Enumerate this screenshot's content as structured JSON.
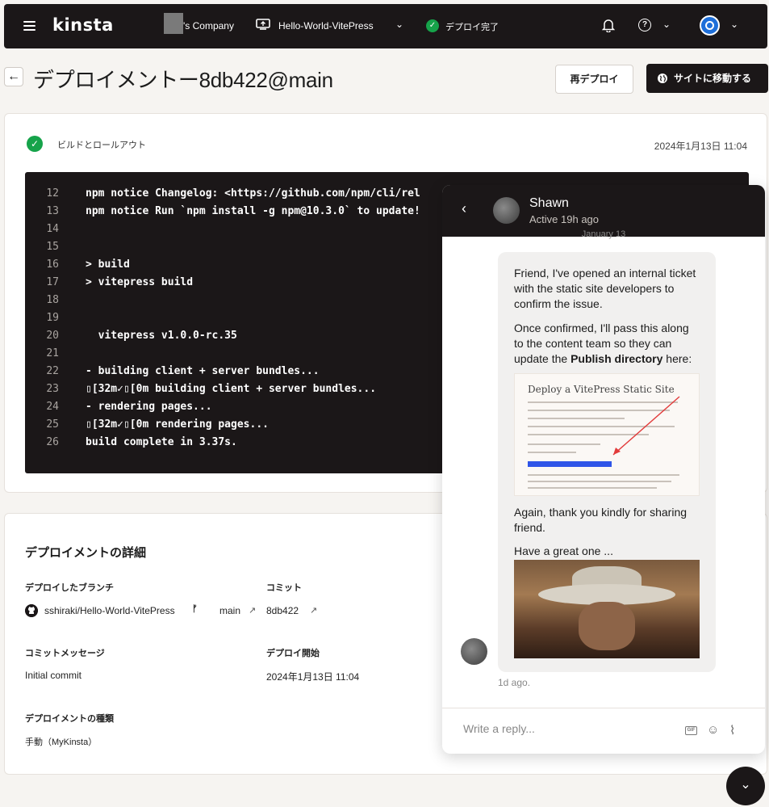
{
  "nav": {
    "logo": "kinsta",
    "company": "'s Company",
    "site": "Hello-World-VitePress",
    "status": "デプロイ完了"
  },
  "header": {
    "title": "デプロイメントー8db422@main",
    "redeploy": "再デプロイ",
    "visit_site": "サイトに移動する"
  },
  "build": {
    "label": "ビルドとロールアウト",
    "date": "2024年1月13日 11:04",
    "console_lines": [
      {
        "n": "12",
        "t": "npm notice Changelog: <https://github.com/npm/cli/rel"
      },
      {
        "n": "13",
        "t": "npm notice Run `npm install -g npm@10.3.0` to update!"
      },
      {
        "n": "14",
        "t": ""
      },
      {
        "n": "15",
        "t": ""
      },
      {
        "n": "16",
        "t": "> build"
      },
      {
        "n": "17",
        "t": "> vitepress build"
      },
      {
        "n": "18",
        "t": ""
      },
      {
        "n": "19",
        "t": ""
      },
      {
        "n": "20",
        "t": "  vitepress v1.0.0-rc.35"
      },
      {
        "n": "21",
        "t": ""
      },
      {
        "n": "22",
        "t": "- building client + server bundles..."
      },
      {
        "n": "23",
        "t": "▯[32m✓▯[0m building client + server bundles..."
      },
      {
        "n": "24",
        "t": "- rendering pages..."
      },
      {
        "n": "25",
        "t": "▯[32m✓▯[0m rendering pages..."
      },
      {
        "n": "26",
        "t": "build complete in 3.37s."
      }
    ]
  },
  "details": {
    "title": "デプロイメントの詳細",
    "branch_label": "デプロイしたブランチ",
    "repo": "sshiraki/Hello-World-VitePress",
    "branch": "main",
    "commit_label": "コミット",
    "commit": "8db422",
    "message_label": "コミットメッセージ",
    "message": "Initial commit",
    "start_label": "デプロイ開始",
    "start": "2024年1月13日 11:04",
    "type_label": "デプロイメントの種類",
    "type": "手動（MyKinsta）"
  },
  "chat": {
    "agent_name": "Shawn",
    "agent_status": "Active 19h ago",
    "date_sep": "January 13",
    "msg1": "Friend, I've opened an internal ticket with the static site developers to confirm the issue.",
    "msg2_pre": "Once confirmed, I'll pass this along to the content team so they can update the ",
    "msg2_bold": "Publish directory",
    "msg2_post": " here:",
    "shot_title": "Deploy a VitePress Static Site",
    "msg3": "Again, thank you kindly for sharing friend.",
    "msg4": "Have a great one ...",
    "time_ago": "1d ago.",
    "placeholder": "Write a reply..."
  },
  "icons": {
    "menu": "hamburger-icon",
    "status": "check-circle-icon",
    "notifications": "bell-icon",
    "help": "help-circle-icon",
    "github": "github-icon",
    "branch": "branch-icon",
    "external": "external-link-icon",
    "emoji": "smiley-icon",
    "attach": "paperclip-icon"
  },
  "colors": {
    "dark": "#1b1718",
    "success": "#16a34a",
    "highlight": "#2f55e8"
  }
}
